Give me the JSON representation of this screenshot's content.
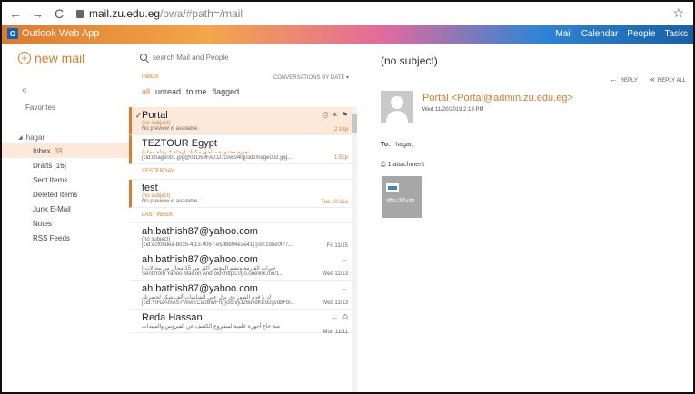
{
  "browser": {
    "domain": "mail.zu.edu.eg",
    "path": "/owa/#path=/mail",
    "back_icon": "←",
    "forward_icon": "→",
    "reload_icon": "C",
    "star_icon": "☆"
  },
  "header": {
    "app_title": "Outlook Web App",
    "logo_glyph": "O",
    "nav": [
      "Mail",
      "Calendar",
      "People",
      "Tasks"
    ]
  },
  "sidebar": {
    "new_mail": "new mail",
    "collapse": "«",
    "favorites": "Favorites",
    "account": "hagar",
    "folders": [
      {
        "name": "Inbox",
        "count": "39"
      },
      {
        "name": "Drafts [16]",
        "count": ""
      },
      {
        "name": "Sent Items",
        "count": ""
      },
      {
        "name": "Deleted Items",
        "count": ""
      },
      {
        "name": "Junk E-Mail",
        "count": ""
      },
      {
        "name": "Notes",
        "count": ""
      },
      {
        "name": "RSS Feeds",
        "count": ""
      }
    ]
  },
  "list": {
    "search_placeholder": "search Mail and People",
    "inbox_label": "INBOX",
    "conversations_label": "CONVERSATIONS BY DATE ▾",
    "filters": [
      "all",
      "unread",
      "to me",
      "flagged"
    ],
    "yesterday": "YESTERDAY",
    "last_week": "LAST WEEK",
    "messages": [
      {
        "sender": "Portal",
        "subject": "(no subject)",
        "preview": "No preview is available.",
        "time": "2:13p"
      },
      {
        "sender": "TEZTOUR Egypt",
        "subject": "تغيرة محدودة - الحق مكانك (رحلة + رحلة مجانا)",
        "preview": "[cid:image001.jpg@01D59FA0.D72A6040][cid:image002.jpg...",
        "time": "1:52p"
      },
      {
        "sender": "test",
        "subject": "(no subject)",
        "preview": "No preview is available.",
        "time": "Tue 10:11a"
      },
      {
        "sender": "ah.bathish87@yahoo.com",
        "subject": "(no subject)",
        "preview": "[cid:ecf08dea-b035-4f13-9067-e5d6b94e2e41] [cid:cd5e0f77...",
        "time": "Fri 11/15"
      },
      {
        "sender": "ah.bathish87@yahoo.com",
        "subject": "خبرات القارمة وتضم المؤتمر اكثر من 15 مجال من مجالات ا",
        "preview": "Sent from Yahoo Mail on Android<https://go.onelink.me/1...",
        "time": "Wed 11/13"
      },
      {
        "sender": "ah.bathish87@yahoo.com",
        "subject": "ك يا قدم الصور دي نزل على الشاشات ألف شكر لحضرتك",
        "preview": "[cid:YIHZAmAS7VkwECa0BWFn] [cid:vyJ26uvdKK92gvd8Fbl...",
        "time": "Wed 11/13"
      },
      {
        "sender": "Reda Hassan",
        "subject": "منة خاع أجهزة علمية لمشروع الكشف عن الفيروس والمبيدات",
        "preview": "",
        "time": "Mon 11/11"
      }
    ]
  },
  "reading": {
    "subject": "(no subject)",
    "reply": "REPLY",
    "reply_all": "REPLY ALL",
    "from": "Portal <Portal@admin.zu.edu.eg>",
    "date": "Wed 11/20/2019 2:13 PM",
    "to_label": "To:",
    "to_value": "hagar;",
    "attachments": "1 attachment",
    "attachment_name": "office 365.png"
  },
  "colors": {
    "accent": "#e07a2b",
    "selected_bg": "#fde9d9"
  }
}
